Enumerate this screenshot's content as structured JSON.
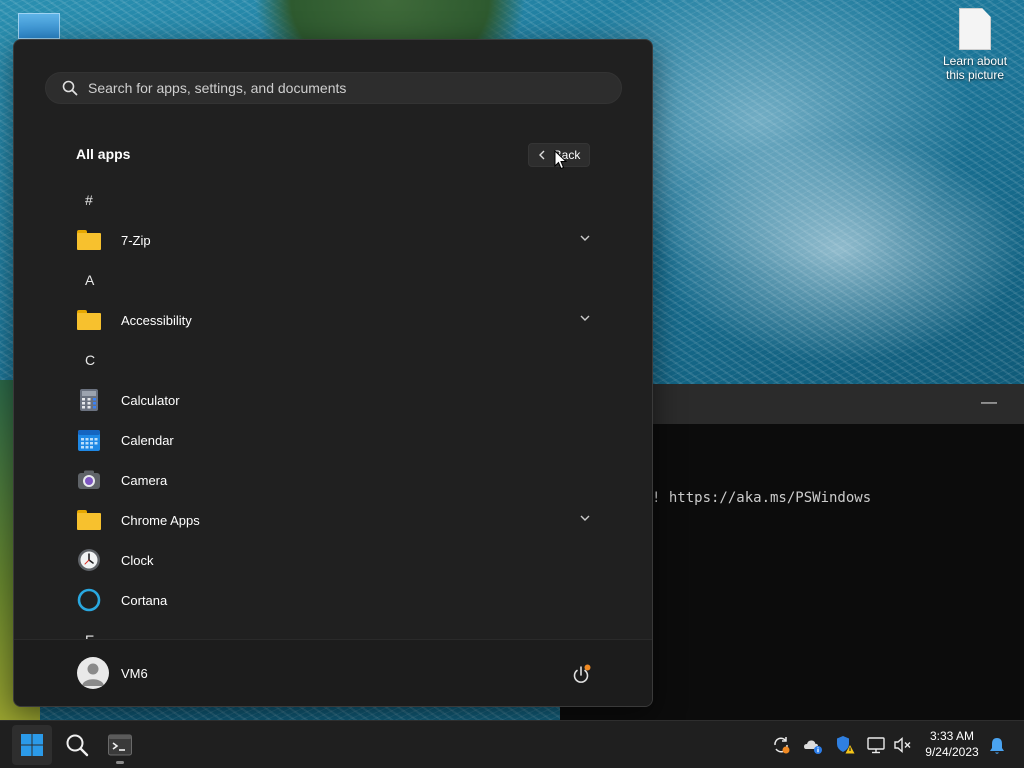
{
  "desktop": {
    "icons": [
      {
        "label": "Learn about this picture"
      }
    ]
  },
  "terminal": {
    "text": "! https://aka.ms/PSWindows",
    "minimize_glyph": "—"
  },
  "start_menu": {
    "search": {
      "placeholder": "Search for apps, settings, and documents",
      "value": ""
    },
    "all_apps_title": "All apps",
    "back_label": "Back",
    "sections": [
      {
        "letter": "#",
        "apps": [
          {
            "name": "7-Zip",
            "icon": "folder-icon",
            "expandable": true
          }
        ]
      },
      {
        "letter": "A",
        "apps": [
          {
            "name": "Accessibility",
            "icon": "folder-icon",
            "expandable": true
          }
        ]
      },
      {
        "letter": "C",
        "apps": [
          {
            "name": "Calculator",
            "icon": "calculator-icon",
            "expandable": false
          },
          {
            "name": "Calendar",
            "icon": "calendar-icon",
            "expandable": false
          },
          {
            "name": "Camera",
            "icon": "camera-icon",
            "expandable": false
          },
          {
            "name": "Chrome Apps",
            "icon": "folder-icon",
            "expandable": true
          },
          {
            "name": "Clock",
            "icon": "clock-icon",
            "expandable": false
          },
          {
            "name": "Cortana",
            "icon": "cortana-icon",
            "expandable": false
          }
        ]
      },
      {
        "letter": "E",
        "apps": []
      }
    ],
    "user": {
      "name": "VM6"
    },
    "power_icon": "power-icon"
  },
  "taskbar": {
    "buttons": [
      "start-icon",
      "search-icon",
      "terminal-icon"
    ],
    "tray_icons": [
      "sync-warning-icon",
      "onedrive-info-icon",
      "defender-warning-icon",
      "network-icon",
      "volume-muted-icon"
    ],
    "time": "3:33 AM",
    "date": "9/24/2023",
    "notification_icon": "bell-icon"
  },
  "colors": {
    "menu_bg": "#202020",
    "folder": "#f7c12e",
    "accent": "#0078d4",
    "notification_badge": "#f08a24"
  }
}
